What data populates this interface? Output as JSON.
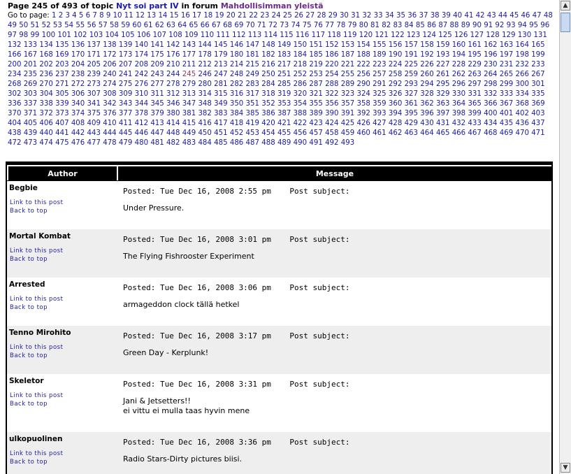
{
  "header": {
    "prefix": "Page 245 of 493 of topic ",
    "topic": "Nyt soi part IV",
    "middle": " in forum ",
    "forum": "Mahdollisimman yleistä"
  },
  "pagination": {
    "label": "Go to page:",
    "current": 245,
    "total": 493
  },
  "table": {
    "author_header": "Author",
    "message_header": "Message"
  },
  "posts": [
    {
      "author": "Begbie",
      "posted": "Posted: Tue Dec 16, 2008 2:55 pm    Post subject:",
      "body": [
        "Under Pressure."
      ],
      "link_post": "Link to this post",
      "back_top": "Back to top"
    },
    {
      "author": "Mortal Kombat",
      "posted": "Posted: Tue Dec 16, 2008 3:01 pm    Post subject:",
      "body": [
        "The Flying Fishrooster Experiment"
      ],
      "link_post": "Link to this post",
      "back_top": "Back to top"
    },
    {
      "author": "Arrested",
      "posted": "Posted: Tue Dec 16, 2008 3:06 pm    Post subject:",
      "body": [
        "armageddon clock tällä hetkel"
      ],
      "link_post": "Link to this post",
      "back_top": "Back to top"
    },
    {
      "author": "Tenno Mirohito",
      "posted": "Posted: Tue Dec 16, 2008 3:17 pm    Post subject:",
      "body": [
        "Green Day - Kerplunk!"
      ],
      "link_post": "Link to this post",
      "back_top": "Back to top"
    },
    {
      "author": "Skeletor",
      "posted": "Posted: Tue Dec 16, 2008 3:31 pm    Post subject:",
      "body": [
        "Jani & Jetsetters!!",
        "ei vittu ei mulla taas hyvin mene"
      ],
      "link_post": "Link to this post",
      "back_top": "Back to top"
    },
    {
      "author": "ulkopuolinen",
      "posted": "Posted: Tue Dec 16, 2008 3:36 pm    Post subject:",
      "body": [
        "Radio Stars-Dirty pictures biisi."
      ],
      "link_post": "Link to this post",
      "back_top": "Back to top"
    }
  ],
  "scrollbar": {
    "up_icon": "arrow-up-icon",
    "down_icon": "arrow-down-icon",
    "up_glyph": "▲",
    "down_glyph": "▼"
  },
  "colors": {
    "link": "#1a1aa6",
    "visited_forum": "#6a2a8a",
    "current_page": "#8a3a5a",
    "header_bg": "#000000",
    "alt_row": "#eeeeee"
  }
}
